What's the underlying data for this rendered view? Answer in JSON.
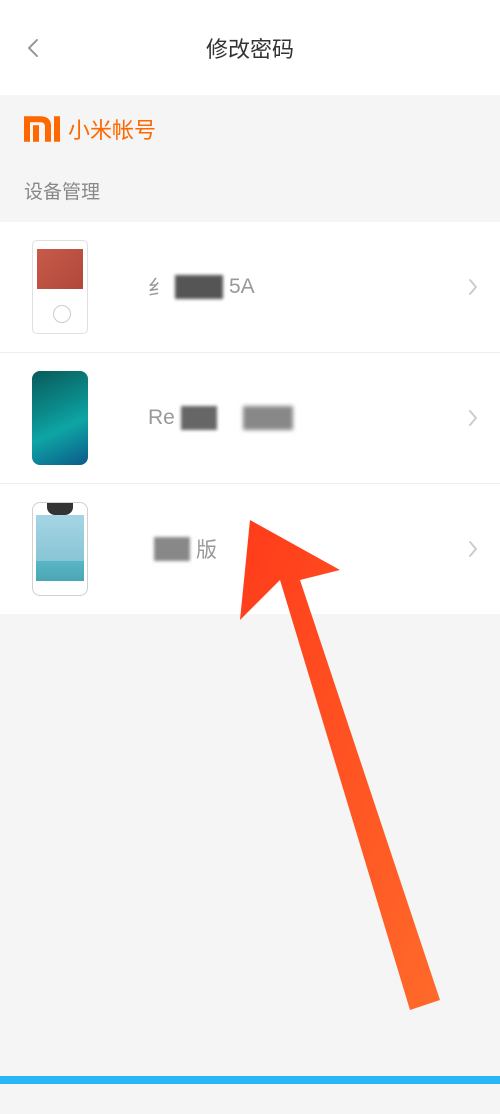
{
  "header": {
    "title": "修改密码"
  },
  "brand": {
    "label": "小米帐号"
  },
  "section": {
    "device_management": "设备管理"
  },
  "devices": [
    {
      "prefix": "纟",
      "suffix": "5A"
    },
    {
      "prefix": "Re",
      "suffix": ""
    },
    {
      "prefix": "",
      "suffix": "版"
    }
  ]
}
